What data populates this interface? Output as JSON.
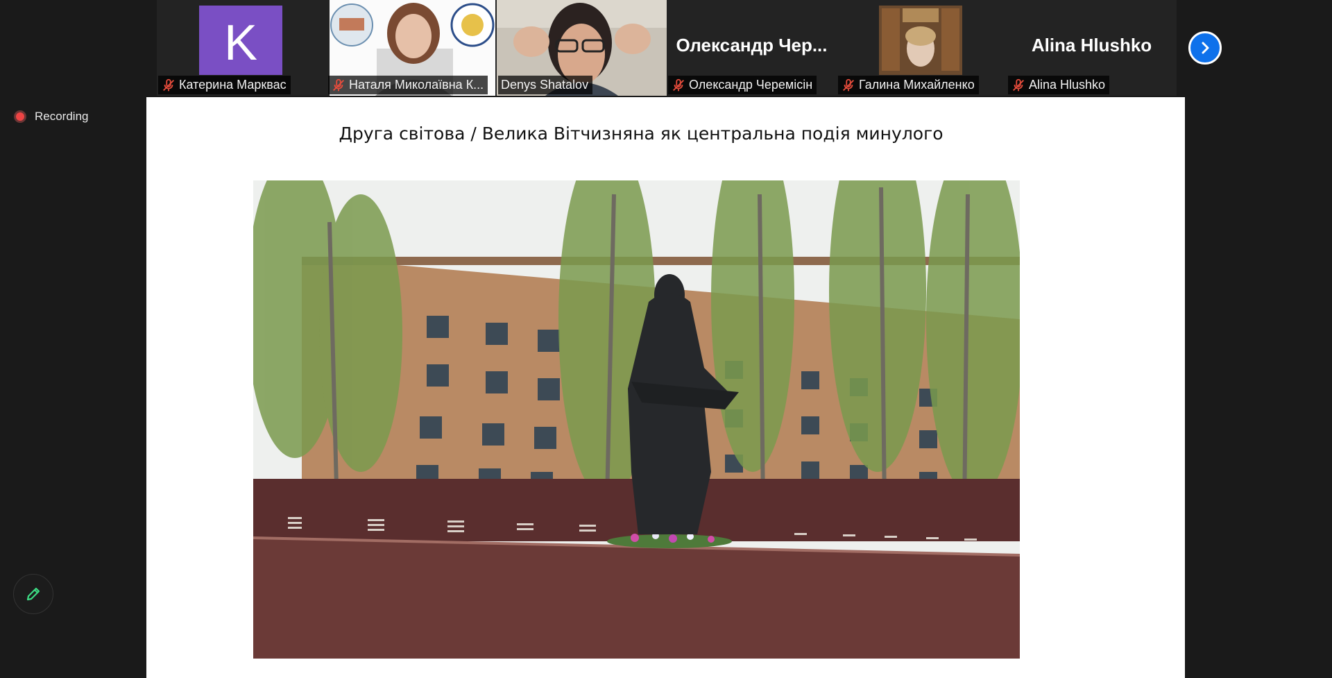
{
  "participants": [
    {
      "name": "Катерина Марквас",
      "avatar_letter": "K",
      "muted": true
    },
    {
      "name": "Наталя Миколаївна К...",
      "muted": true
    },
    {
      "name": "Denys Shatalov",
      "muted": false,
      "active_speaker": true
    },
    {
      "name": "Олександр Черемісін",
      "display_name": "Олександр Чер...",
      "muted": true
    },
    {
      "name": "Галина Михайленко",
      "muted": true
    },
    {
      "name": "Alina Hlushko",
      "display_name": "Alina Hlushko",
      "muted": true
    }
  ],
  "controls": {
    "next_page_icon": "chevron-right-icon",
    "annotate_icon": "pencil-icon"
  },
  "status": {
    "recording_label": "Recording"
  },
  "slide": {
    "title": "Друга світова / Велика Вітчизняна як центральна подія минулого"
  },
  "colors": {
    "active_speaker": "#7ec243",
    "next_button": "#0e71eb",
    "avatar_k": "#7a4fc4",
    "recording_dot": "#e44444",
    "pen_icon": "#3ddc84"
  }
}
